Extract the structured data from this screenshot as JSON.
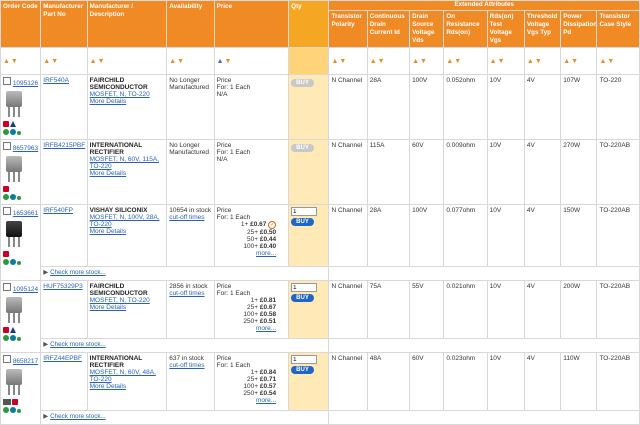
{
  "headers": {
    "order_code": "Order Code",
    "manufacturer_part_no": "Manufacturer Part No",
    "manufacturer_description": "Manufacturer / Description",
    "availability": "Availability",
    "price": "Price",
    "qty": "Qty",
    "extended_attributes": "Extended Attributes",
    "transistor_polarity": "Transistor Polarity",
    "continuous_drain_current": "Continuous Drain Current Id",
    "drain_source_voltage": "Drain Source Voltage Vds",
    "on_resistance": "On Resistance Rds(on)",
    "rds_test_voltage": "Rds(on) Test Voltage Vgs",
    "threshold_voltage": "Threshold Voltage Vgs Typ",
    "power_dissipation": "Power Dissipation Pd",
    "transistor_case_style": "Transistor Case Style"
  },
  "products": [
    {
      "order_code": "1095126",
      "part_no": "IRF540A",
      "manufacturer": "FAIRCHILD SEMICONDUCTOR",
      "description": "MOSFET, N, TO-220",
      "more_details": "More Details",
      "availability": "No Longer Manufactured",
      "price_label": "Price",
      "price_for": "For: 1 Each",
      "price_value": "N/A",
      "buy_label": "BUY",
      "polarity": "N Channel",
      "current": "28A",
      "voltage": "100V",
      "resistance": "0.052ohm",
      "test_voltage": "10V",
      "threshold": "4V",
      "power": "107W",
      "case": "TO-220"
    },
    {
      "order_code": "8657963",
      "part_no": "IRFB4215PBF",
      "manufacturer": "INTERNATIONAL RECTIFIER",
      "description": "MOSFET, N, 60V, 115A, TO-220",
      "more_details": "More Details",
      "availability": "No Longer Manufactured",
      "price_label": "Price",
      "price_for": "For: 1 Each",
      "price_value": "N/A",
      "buy_label": "BUY",
      "polarity": "N Channel",
      "current": "115A",
      "voltage": "60V",
      "resistance": "0.009ohm",
      "test_voltage": "10V",
      "threshold": "4V",
      "power": "270W",
      "case": "TO-220AB"
    },
    {
      "order_code": "1653661",
      "part_no": "IRF540FP",
      "manufacturer": "VISHAY SILICONIX",
      "description": "MOSFET, N, 100V, 28A, TO-220",
      "more_details": "More Details",
      "stock": "10654 in stock",
      "cutoff": "cut-off times",
      "price_label": "Price",
      "price_for": "For: 1 Each",
      "tiers": [
        {
          "qty": "1+",
          "price": "£0.67"
        },
        {
          "qty": "25+",
          "price": "£0.50"
        },
        {
          "qty": "50+",
          "price": "£0.44"
        },
        {
          "qty": "100+",
          "price": "£0.40"
        }
      ],
      "more": "more...",
      "qty_value": "1",
      "buy_label": "BUY",
      "check_more": "Check more stock...",
      "polarity": "N Channel",
      "current": "28A",
      "voltage": "100V",
      "resistance": "0.077ohm",
      "test_voltage": "10V",
      "threshold": "4V",
      "power": "150W",
      "case": "TO-220AB"
    },
    {
      "order_code": "1095124",
      "part_no": "HUF75329P3",
      "manufacturer": "FAIRCHILD SEMICONDUCTOR",
      "description": "MOSFET, N, TO-220",
      "more_details": "More Details",
      "stock": "2856 in stock",
      "cutoff": "cut-off times",
      "price_label": "Price",
      "price_for": "For: 1 Each",
      "tiers": [
        {
          "qty": "1+",
          "price": "£0.81"
        },
        {
          "qty": "25+",
          "price": "£0.67"
        },
        {
          "qty": "100+",
          "price": "£0.58"
        },
        {
          "qty": "250+",
          "price": "£0.51"
        }
      ],
      "more": "more...",
      "qty_value": "1",
      "buy_label": "BUY",
      "check_more": "Check more stock...",
      "polarity": "N Channel",
      "current": "75A",
      "voltage": "55V",
      "resistance": "0.021ohm",
      "test_voltage": "10V",
      "threshold": "4V",
      "power": "200W",
      "case": "TO-220AB"
    },
    {
      "order_code": "8658217",
      "part_no": "IRFZ44EPBF",
      "manufacturer": "INTERNATIONAL RECTIFIER",
      "description": "MOSFET, N, 60V, 48A, TO-220",
      "more_details": "More Details",
      "stock": "637 in stock",
      "cutoff": "cut-off times",
      "price_label": "Price",
      "price_for": "For: 1 Each",
      "tiers": [
        {
          "qty": "1+",
          "price": "£0.84"
        },
        {
          "qty": "25+",
          "price": "£0.71"
        },
        {
          "qty": "100+",
          "price": "£0.57"
        },
        {
          "qty": "250+",
          "price": "£0.54"
        }
      ],
      "more": "more...",
      "qty_value": "1",
      "buy_label": "BUY",
      "check_more": "Check more stock...",
      "polarity": "N Channel",
      "current": "48A",
      "voltage": "60V",
      "resistance": "0.023ohm",
      "test_voltage": "10V",
      "threshold": "4V",
      "power": "110W",
      "case": "TO-220AB"
    }
  ]
}
